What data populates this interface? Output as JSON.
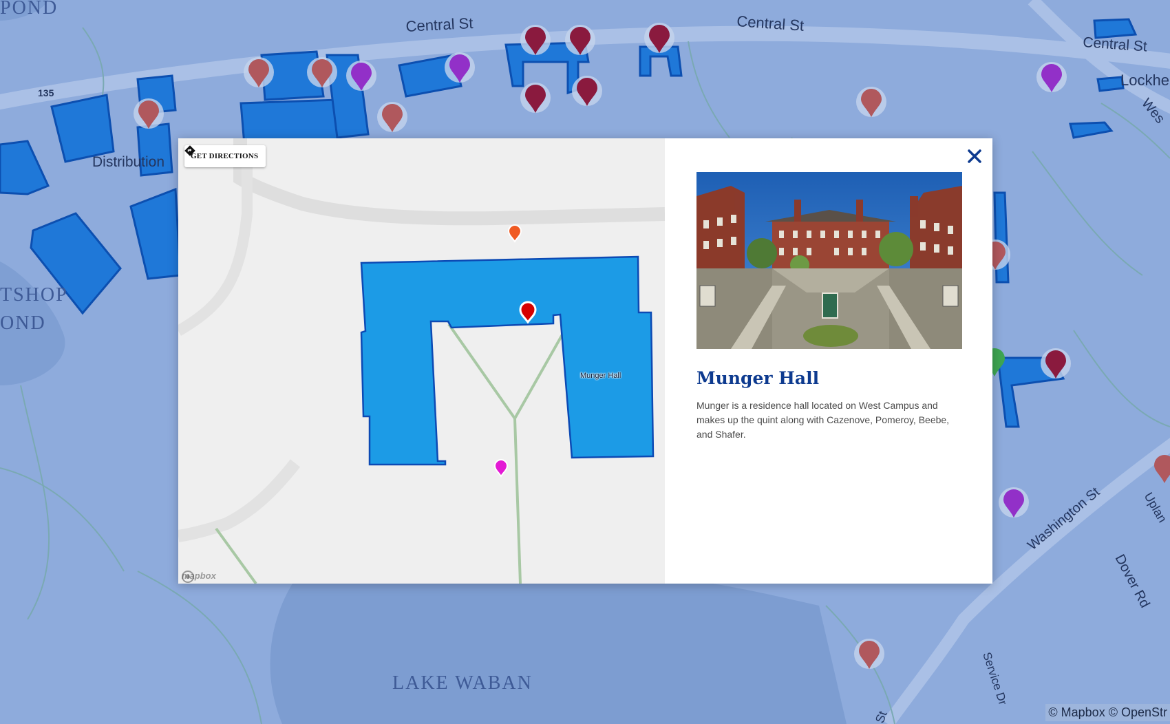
{
  "background_map": {
    "street_labels": [
      "Central St",
      "Central St",
      "Central St",
      "Washington St",
      "Dover Rd",
      "Service Dr",
      "Lockhe",
      "Wes",
      "Uplan",
      "St"
    ],
    "route_label": "135",
    "place_labels": [
      "Distribution"
    ],
    "water_labels": [
      "LAKE WABAN",
      "TSHOP",
      "OND",
      "POND"
    ],
    "attribution": "© Mapbox © OpenStr",
    "colors": {
      "base": "#8faadb",
      "water": "#7f9ed2",
      "building": "#1f78d8",
      "road": "#a9bde3",
      "path": "#7aaab3"
    },
    "markers": [
      {
        "icon": "map-pin-icon",
        "color": "#b0585d"
      },
      {
        "icon": "map-pin-icon",
        "color": "#b0585d"
      },
      {
        "icon": "map-pin-icon",
        "color": "#9230c8"
      },
      {
        "icon": "map-pin-icon",
        "color": "#9230c8"
      },
      {
        "icon": "map-pin-icon",
        "color": "#8a1a3e"
      },
      {
        "icon": "map-pin-icon",
        "color": "#3ea552"
      }
    ]
  },
  "modal": {
    "directions": {
      "label": "GET DIRECTIONS",
      "icon": "directions-diamond-icon"
    },
    "inset_map": {
      "building_label": "Munger Hall",
      "logo_text": "mapbox",
      "building_color": "#1c9be6",
      "markers": [
        {
          "icon": "map-pin-icon",
          "color": "#f05a22"
        },
        {
          "icon": "map-pin-icon",
          "color": "#d60000",
          "selected": true
        },
        {
          "icon": "map-pin-icon",
          "color": "#e31ad4"
        }
      ]
    },
    "close": {
      "icon": "close-icon",
      "color": "#0d3a8f"
    },
    "photo": {
      "alt": "Munger Hall courtyard"
    },
    "title": "Munger Hall",
    "description": "Munger is a residence hall located on West Campus and makes up the quint along with Cazenove, Pomeroy, Beebe, and Shafer."
  }
}
